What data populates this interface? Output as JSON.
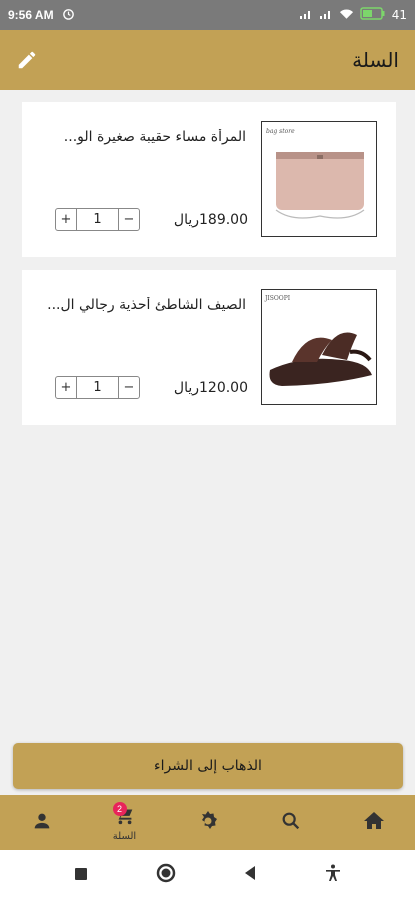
{
  "status_bar": {
    "time": "9:56 AM",
    "battery": "41"
  },
  "app_bar": {
    "title": "السلة"
  },
  "cart": {
    "items": [
      {
        "name": "المرأة مساء حقيبة صغيرة الو...",
        "price": "189.00ريال",
        "quantity": "1",
        "image_label": "bag-clutch",
        "image_text": "bag store"
      },
      {
        "name": "الصيف الشاطئ أحذية رجالي ال...",
        "price": "120.00ريال",
        "quantity": "1",
        "image_label": "sandal",
        "image_text": "JISOOPI"
      }
    ],
    "plus_symbol": "+",
    "minus_symbol": "−"
  },
  "checkout": {
    "label": "الذهاب إلى الشراء"
  },
  "bottom_nav": {
    "items": [
      {
        "icon": "person-icon",
        "label": ""
      },
      {
        "icon": "cart-icon",
        "label": "السلة",
        "badge": "2"
      },
      {
        "icon": "gear-icon",
        "label": ""
      },
      {
        "icon": "search-icon",
        "label": ""
      },
      {
        "icon": "home-icon",
        "label": ""
      }
    ]
  },
  "colors": {
    "accent": "#c2a155",
    "badge": "#e8245a",
    "background": "#f0f0f0"
  }
}
